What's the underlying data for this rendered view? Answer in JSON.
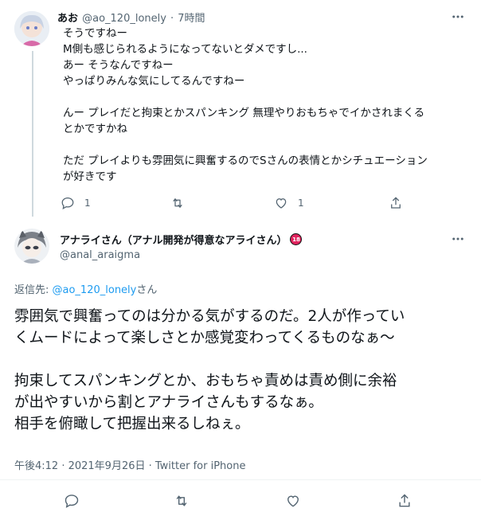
{
  "reply_tweet": {
    "display_name": "あお",
    "handle": "@ao_120_lonely",
    "separator": "·",
    "time": "7時間",
    "body": "そうですねー\nM側も感じられるようになってないとダメですし...\nあー そうなんですねー\nやっぱりみんな気にしてるんですねー\n\nんー プレイだと拘束とかスパンキング 無理やりおもちゃでイかされまくる\nとかですかね\n\nただ プレイよりも雰囲気に興奮するのでSさんの表情とかシチュエーション\nが好きです",
    "reply_count": "1",
    "like_count": "1"
  },
  "main_tweet": {
    "display_name": "アナライさん（アナル開発が得意なアライさん）",
    "badge": "18",
    "handle": "@anal_araigma",
    "reply_to_prefix": "返信先: ",
    "reply_to_handle": "@ao_120_lonely",
    "reply_to_suffix": "さん",
    "body": "雰囲気で興奮ってのは分かる気がするのだ。2人が作ってい\nくムードによって楽しさとか感覚変わってくるものなぁ〜\n\n拘束してスパンキングとか、おもちゃ責めは責め側に余裕\nが出やすいから割とアナライさんもするなぁ。\n相手を俯瞰して把握出来るしねぇ。",
    "meta": "午後4:12 · 2021年9月26日 · Twitter for iPhone"
  },
  "icons": [
    "more-icon",
    "reply-icon",
    "retweet-icon",
    "like-icon",
    "share-icon"
  ],
  "colors": {
    "link": "#1d9bf0",
    "muted": "#536471",
    "text": "#0f1419"
  }
}
